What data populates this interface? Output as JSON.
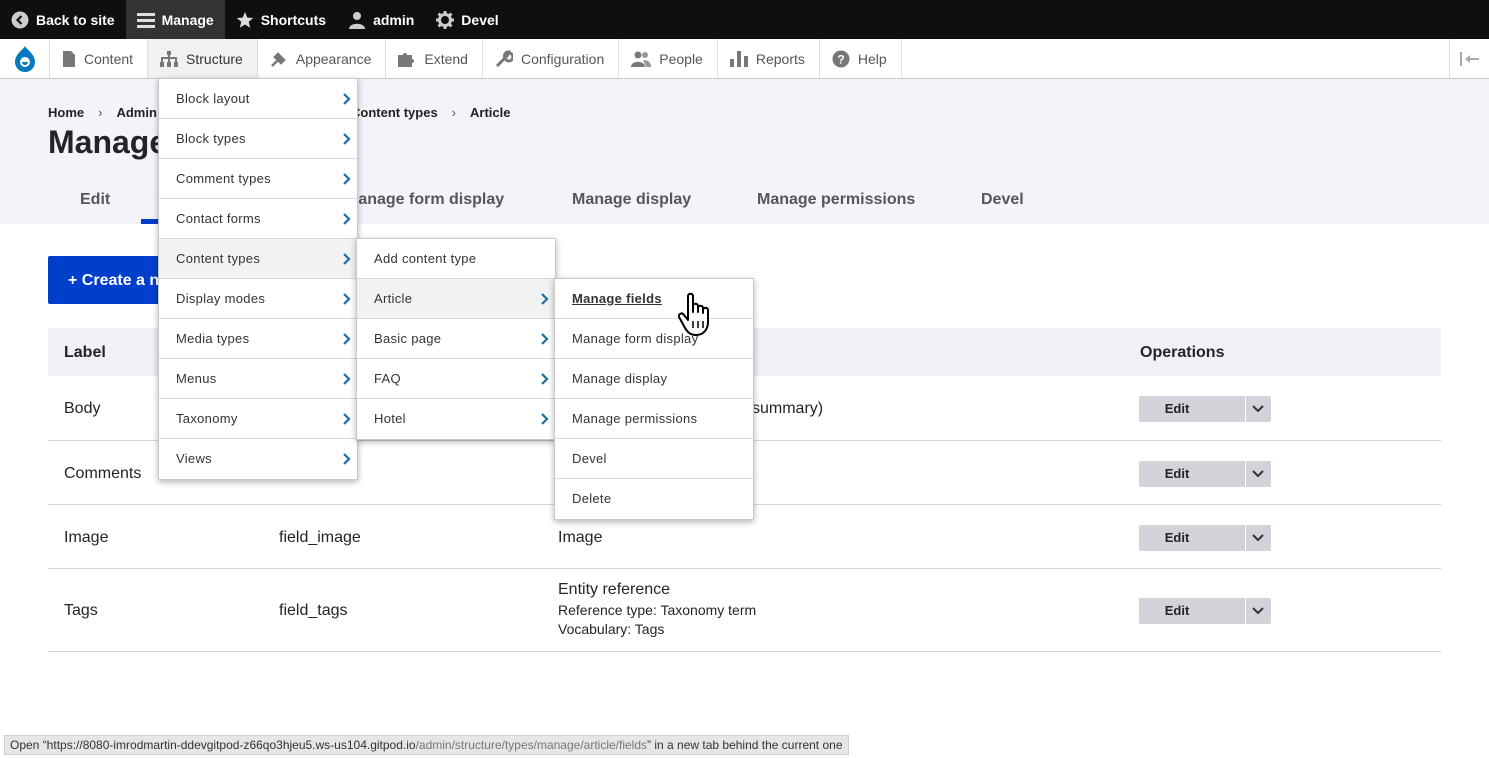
{
  "toolbar": {
    "back": "Back to site",
    "manage": "Manage",
    "shortcuts": "Shortcuts",
    "user": "admin",
    "devel": "Devel"
  },
  "tray": {
    "items": [
      "Content",
      "Structure",
      "Appearance",
      "Extend",
      "Configuration",
      "People",
      "Reports",
      "Help"
    ]
  },
  "breadcrumb": [
    "Home",
    "Admin",
    "Content types",
    "Article"
  ],
  "page_title": "Manage",
  "tabs": [
    "Edit",
    "Manage form display",
    "Manage display",
    "Manage permissions",
    "Devel"
  ],
  "create_button": "+ Create a new field",
  "table": {
    "headers": {
      "label": "Label",
      "operations": "Operations"
    },
    "rows": [
      {
        "label": "Body",
        "machine": "",
        "type": "summary)",
        "type_lines": []
      },
      {
        "label": "Comments",
        "machine": "",
        "type": "",
        "type_lines": []
      },
      {
        "label": "Image",
        "machine": "field_image",
        "type": "Image",
        "type_lines": []
      },
      {
        "label": "Tags",
        "machine": "field_tags",
        "type": "Entity reference",
        "type_lines": [
          "Reference type: Taxonomy term",
          "Vocabulary: Tags"
        ]
      }
    ],
    "edit_label": "Edit"
  },
  "menu_structure": [
    "Block layout",
    "Block types",
    "Comment types",
    "Contact forms",
    "Content types",
    "Display modes",
    "Media types",
    "Menus",
    "Taxonomy",
    "Views"
  ],
  "menu_content_types": [
    "Add content type",
    "Article",
    "Basic page",
    "FAQ",
    "Hotel"
  ],
  "menu_article": [
    "Manage fields",
    "Manage form display",
    "Manage display",
    "Manage permissions",
    "Devel",
    "Delete"
  ],
  "statusbar": {
    "prefix": "Open “https://8080-imrodmartin-ddevgitpod-z66qo3hjeu5.ws-us104.gitpod.io",
    "path": "/admin/structure/types/manage/article/fields",
    "suffix": "” in a new tab behind the current one"
  },
  "colors": {
    "accent": "#003ecc",
    "toolbar_bg": "#0f0f0f",
    "chevron": "#1b6fa5"
  }
}
